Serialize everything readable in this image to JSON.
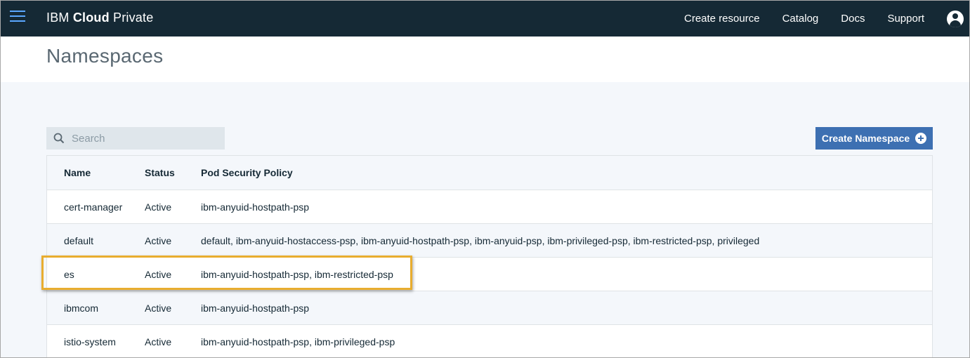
{
  "header": {
    "brand_prefix": "IBM ",
    "brand_bold": "Cloud",
    "brand_suffix": " Private",
    "nav": [
      "Create resource",
      "Catalog",
      "Docs",
      "Support"
    ]
  },
  "page": {
    "title": "Namespaces"
  },
  "search": {
    "placeholder": "Search"
  },
  "actions": {
    "create_label": "Create Namespace"
  },
  "table": {
    "columns": [
      "Name",
      "Status",
      "Pod Security Policy"
    ],
    "rows": [
      {
        "name": "cert-manager",
        "status": "Active",
        "psp": "ibm-anyuid-hostpath-psp"
      },
      {
        "name": "default",
        "status": "Active",
        "psp": "default, ibm-anyuid-hostaccess-psp, ibm-anyuid-hostpath-psp, ibm-anyuid-psp, ibm-privileged-psp, ibm-restricted-psp, privileged"
      },
      {
        "name": "es",
        "status": "Active",
        "psp": "ibm-anyuid-hostpath-psp, ibm-restricted-psp"
      },
      {
        "name": "ibmcom",
        "status": "Active",
        "psp": "ibm-anyuid-hostpath-psp"
      },
      {
        "name": "istio-system",
        "status": "Active",
        "psp": "ibm-anyuid-hostpath-psp, ibm-privileged-psp"
      }
    ]
  },
  "colors": {
    "topbar": "#152935",
    "accent": "#3d70b2",
    "highlight": "#e8ad2f"
  }
}
